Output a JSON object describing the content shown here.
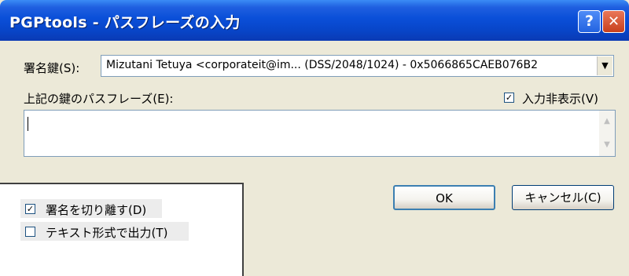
{
  "window": {
    "title": "PGPtools - パスフレーズの入力",
    "help_button": "?",
    "close_button": "✕"
  },
  "signing_key": {
    "label": "署名鍵(S):",
    "value": "Mizutani Tetuya <corporateit@im...   (DSS/2048/1024) - 0x5066865CAEB076B2"
  },
  "passphrase": {
    "label": "上記の鍵のパスフレーズ(E):",
    "value": "",
    "hide_input": {
      "label": "入力非表示(V)",
      "checked": true
    }
  },
  "options": {
    "detach_signature": {
      "label": "署名を切り離す(D)",
      "checked": true
    },
    "text_output": {
      "label": "テキスト形式で出力(T)",
      "checked": false
    }
  },
  "buttons": {
    "ok": "OK",
    "cancel": "キャンセル(C)"
  },
  "icons": {
    "checkmark": "✓",
    "dropdown": "▼",
    "scroll_up": "▲",
    "scroll_down": "▼"
  }
}
